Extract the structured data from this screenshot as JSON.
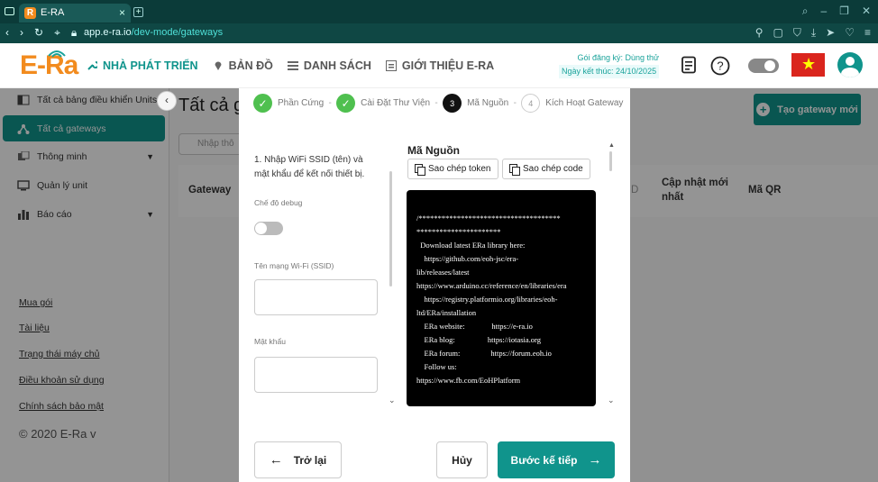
{
  "browser": {
    "tab_title": "E-RA",
    "tab_favicon": "R",
    "url_host": "app.e-ra.io",
    "url_path": "/dev-mode/gateways"
  },
  "header": {
    "logo": "E-Ra",
    "nav": [
      {
        "label": "NHÀ PHÁT TRIỂN",
        "icon": "wrench-icon",
        "active": true
      },
      {
        "label": "BẢN ĐỒ",
        "icon": "map-pin-icon",
        "active": false
      },
      {
        "label": "DANH SÁCH",
        "icon": "list-icon",
        "active": false
      },
      {
        "label": "GIỚI THIỆU E-RA",
        "icon": "info-card-icon",
        "active": false
      }
    ],
    "plan_label": "Gói đăng ký: Dùng thử",
    "expiry_label": "Ngày kết thúc: 24/10/2025",
    "accent": "#10948c"
  },
  "sidebar": {
    "items": [
      {
        "label": "Tất cả bảng điều khiển Units",
        "active": false,
        "has_caret": false
      },
      {
        "label": "Tất cả gateways",
        "active": true,
        "has_caret": false
      },
      {
        "label": "Thông minh",
        "active": false,
        "has_caret": true
      },
      {
        "label": "Quản lý unit",
        "active": false,
        "has_caret": false
      },
      {
        "label": "Báo cáo",
        "active": false,
        "has_caret": true
      }
    ],
    "links": [
      "Mua gói",
      "Tài liệu",
      "Trạng thái máy chủ",
      "Điều khoản sử dụng",
      "Chính sách bảo mật"
    ],
    "copyright": "© 2020 E-Ra v"
  },
  "main": {
    "title": "Tất cả g",
    "search_placeholder": "Nhập thô",
    "create_button": "Tạo gateway mới",
    "columns": {
      "gateway": "Gateway",
      "d": "D",
      "updated": "Cập nhật mới nhất",
      "qr": "Mã QR"
    }
  },
  "modal": {
    "steps": [
      {
        "number": "1",
        "label": "Phần Cứng",
        "state": "done"
      },
      {
        "number": "2",
        "label": "Cài Đặt Thư Viện",
        "state": "done"
      },
      {
        "number": "3",
        "label": "Mã Nguồn",
        "state": "current"
      },
      {
        "number": "4",
        "label": "Kích Hoạt Gateway",
        "state": "todo"
      }
    ],
    "instruction": "1. Nhập WiFi SSID (tên) và mật khẩu để kết nối thiết bị.",
    "debug_label": "Chế độ debug",
    "ssid_label": "Tên mạng Wi-Fi (SSID)",
    "password_label": "Mật khẩu",
    "code_title": "Mã Nguồn",
    "copy_token": "Sao chép token",
    "copy_code": "Sao chép code",
    "code_lines": [
      "/*************************************",
      "**********************",
      "  Download latest ERa library here:",
      "    https://github.com/eoh-jsc/era-",
      "lib/releases/latest",
      "",
      "https://www.arduino.cc/reference/en/libraries/era",
      "    https://registry.platformio.org/libraries/eoh-",
      "ltd/ERa/installation",
      "",
      "    ERa website:              https://e-ra.io",
      "    ERa blog:                 https://iotasia.org",
      "    ERa forum:                https://forum.eoh.io",
      "    Follow us:",
      "https://www.fb.com/EoHPlatform"
    ],
    "back_button": "Trở lại",
    "cancel_button": "Hủy",
    "next_button": "Bước kế tiếp"
  }
}
